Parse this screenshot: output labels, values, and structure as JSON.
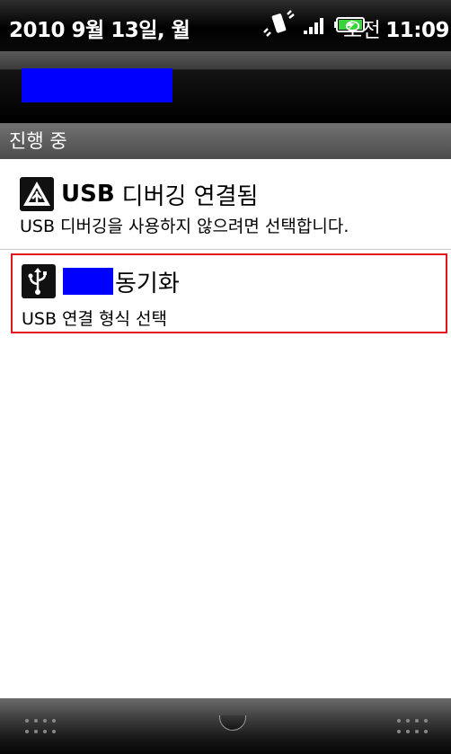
{
  "status_bar": {
    "date": "2010 9월 13일, 월",
    "ampm": "오전",
    "time": "11:09",
    "icons": [
      "vibrate-icon",
      "signal-icon",
      "battery-charging-icon"
    ]
  },
  "section_header": "진행 중",
  "notifications": [
    {
      "icon": "warning-triangle-icon",
      "title_bold": "USB",
      "title_rest": "디버깅 연결됨",
      "text": "USB 디버깅을 사용하지 않으려면 선택합니다."
    },
    {
      "icon": "usb-icon",
      "title_rest": "동기화",
      "text": "USB 연결 형식 선택"
    }
  ],
  "colors": {
    "redaction": "#0000ff",
    "highlight_border": "#e2161c",
    "battery_fill": "#3ad33a"
  }
}
